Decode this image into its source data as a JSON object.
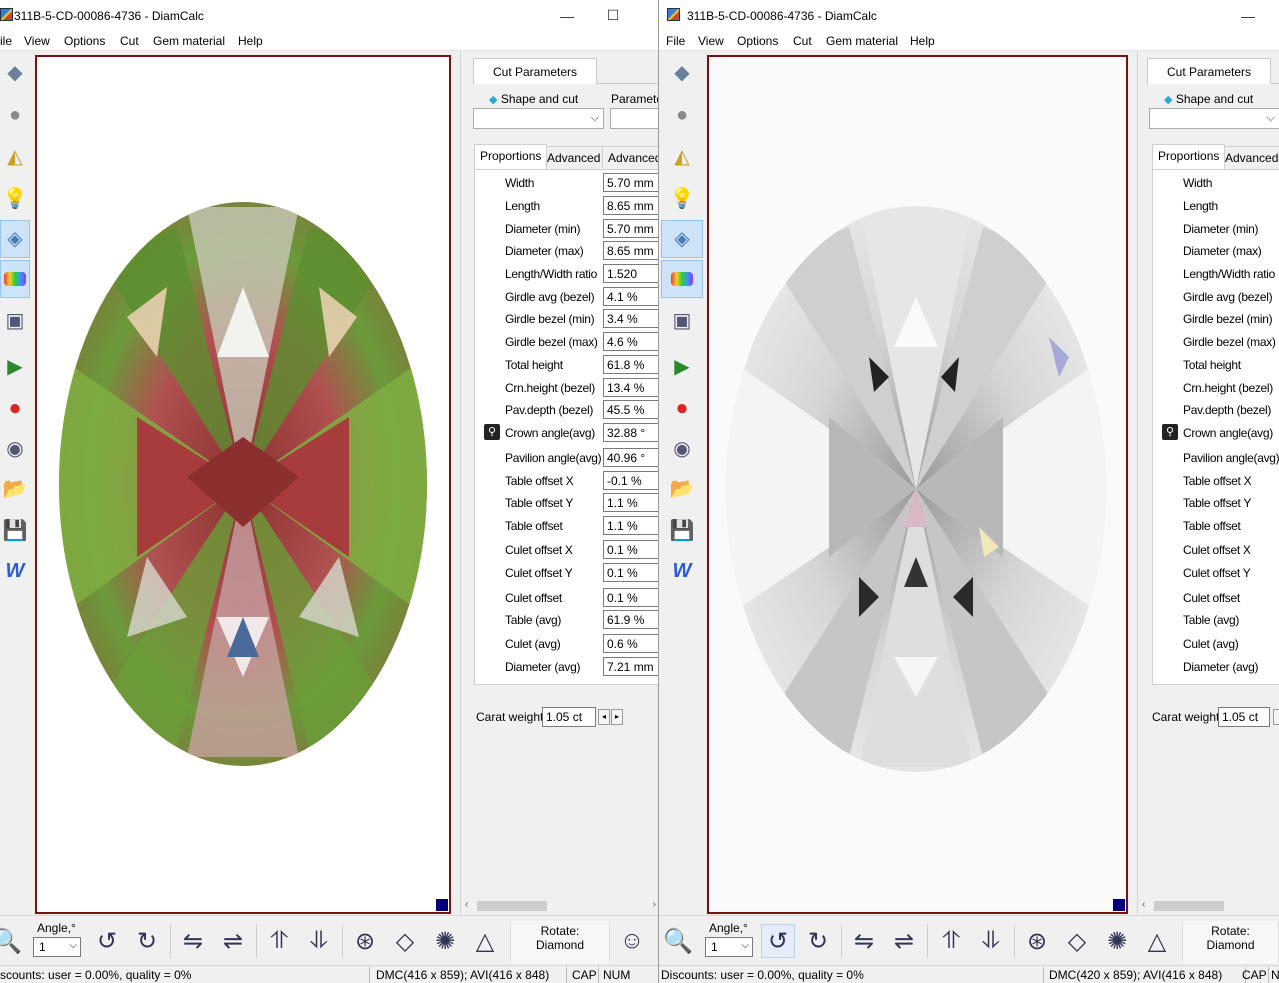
{
  "windows": [
    {
      "title": "311B-5-CD-00086-4736 - DiamCalc",
      "menu": [
        "ile",
        "View",
        "Options",
        "Cut",
        "Gem material",
        "Help"
      ],
      "panel": {
        "tab": "Cut Parameters",
        "shape_label": "Shape and cut",
        "param_label": "Parameter",
        "subtabs": [
          "Proportions",
          "Advanced",
          "Advanced"
        ],
        "rows": [
          {
            "label": "Width",
            "value": "5.70 mm"
          },
          {
            "label": "Length",
            "value": "8.65 mm"
          },
          {
            "label": "Diameter (min)",
            "value": "5.70 mm"
          },
          {
            "label": "Diameter (max)",
            "value": "8.65 mm"
          },
          {
            "label": "Length/Width ratio",
            "value": "1.520"
          },
          {
            "label": "Girdle avg (bezel)",
            "value": "4.1 %"
          },
          {
            "label": "Girdle bezel (min)",
            "value": "3.4 %"
          },
          {
            "label": "Girdle bezel (max)",
            "value": "4.6 %"
          },
          {
            "label": "Total height",
            "value": "61.8 %"
          },
          {
            "label": "Crn.height (bezel)",
            "value": "13.4 %"
          },
          {
            "label": "Pav.depth (bezel)",
            "value": "45.5 %"
          },
          {
            "label": "Crown angle(avg)",
            "value": "32.88 °"
          },
          {
            "label": "Pavilion angle(avg)",
            "value": "40.96 °"
          },
          {
            "label": "Table offset X",
            "value": "-0.1 %"
          },
          {
            "label": "Table offset Y",
            "value": "1.1 %"
          },
          {
            "label": "Table offset",
            "value": "1.1 %"
          },
          {
            "label": "Culet offset X",
            "value": "0.1 %"
          },
          {
            "label": "Culet offset Y",
            "value": "0.1 %"
          },
          {
            "label": "Culet offset",
            "value": "0.1 %"
          },
          {
            "label": "Table (avg)",
            "value": "61.9 %"
          },
          {
            "label": "Culet (avg)",
            "value": "0.6 %"
          },
          {
            "label": "Diameter (avg)",
            "value": "7.21 mm"
          }
        ],
        "carat_label": "Carat weight",
        "carat_value": "1.05 ct"
      },
      "bottom": {
        "angle_label": "Angle,°",
        "angle_value": "1",
        "rotate_label": "Rotate:",
        "rotate_value": "Diamond"
      },
      "status": {
        "discounts": "scounts: user = 0.00%, quality = 0%",
        "dims": "DMC(416 x 859); AVI(416 x 848)",
        "cap": "CAP",
        "num": "NUM"
      }
    },
    {
      "title": "311B-5-CD-00086-4736 - DiamCalc",
      "menu": [
        "File",
        "View",
        "Options",
        "Cut",
        "Gem material",
        "Help"
      ],
      "panel": {
        "tab": "Cut Parameters",
        "shape_label": "Shape and cut",
        "subtabs": [
          "Proportions",
          "Advanced"
        ],
        "rows": [
          {
            "label": "Width"
          },
          {
            "label": "Length"
          },
          {
            "label": "Diameter (min)"
          },
          {
            "label": "Diameter (max)"
          },
          {
            "label": "Length/Width ratio"
          },
          {
            "label": "Girdle avg (bezel)"
          },
          {
            "label": "Girdle bezel (min)"
          },
          {
            "label": "Girdle bezel (max)"
          },
          {
            "label": "Total height"
          },
          {
            "label": "Crn.height (bezel)"
          },
          {
            "label": "Pav.depth (bezel)"
          },
          {
            "label": "Crown angle(avg)"
          },
          {
            "label": "Pavilion angle(avg)"
          },
          {
            "label": "Table offset X"
          },
          {
            "label": "Table offset Y"
          },
          {
            "label": "Table offset"
          },
          {
            "label": "Culet offset X"
          },
          {
            "label": "Culet offset Y"
          },
          {
            "label": "Culet offset"
          },
          {
            "label": "Table (avg)"
          },
          {
            "label": "Culet (avg)"
          },
          {
            "label": "Diameter (avg)"
          }
        ],
        "carat_label": "Carat weight",
        "carat_value": "1.05 ct"
      },
      "bottom": {
        "angle_label": "Angle,°",
        "angle_value": "1",
        "rotate_label": "Rotate:",
        "rotate_value": "Diamond"
      },
      "status": {
        "discounts": "Discounts: user = 0.00%, quality = 0%",
        "dims": "DMC(420 x 859); AVI(416 x 848)",
        "cap": "CAP",
        "num": "N"
      }
    }
  ],
  "colors": {
    "viewport_border": "#7a1010",
    "corner_marker": "#00007f",
    "active_tool": "#cde3f7"
  }
}
